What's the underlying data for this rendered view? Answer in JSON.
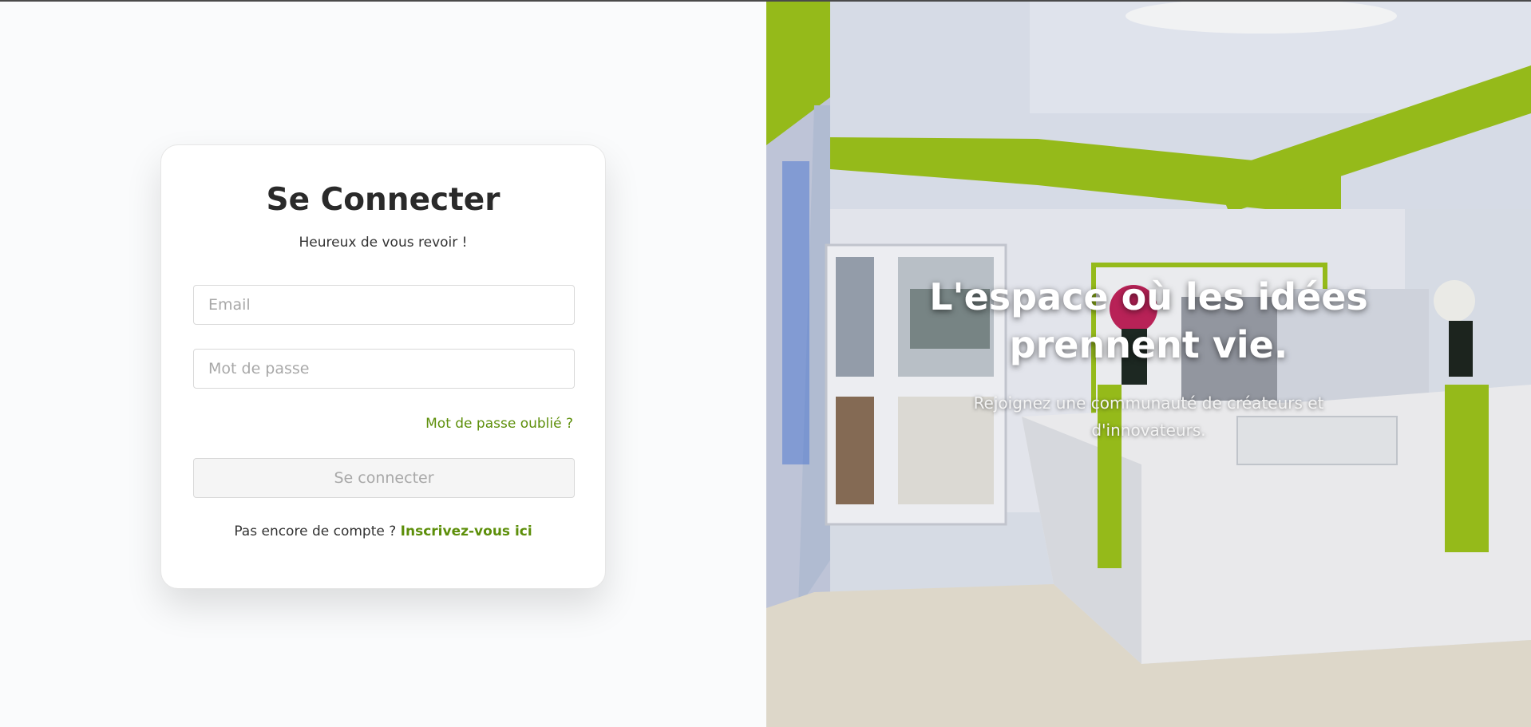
{
  "login_card": {
    "title": "Se Connecter",
    "subtitle": "Heureux de vous revoir !",
    "email_placeholder": "Email",
    "password_placeholder": "Mot de passe",
    "forgot_password_link": "Mot de passe oublié ?",
    "submit_label": "Se connecter",
    "signup_prompt": "Pas encore de compte ?",
    "signup_link": "Inscrivez-vous ici"
  },
  "hero": {
    "title_line1": "L'espace où les idées",
    "title_line2": "prennent vie.",
    "subtitle": "Rejoignez une communauté de créateurs et d'innovateurs."
  },
  "colors": {
    "accent": "#5d8f0a",
    "brand_lime": "#9cc21c",
    "button_disabled_bg": "#f5f5f5"
  }
}
